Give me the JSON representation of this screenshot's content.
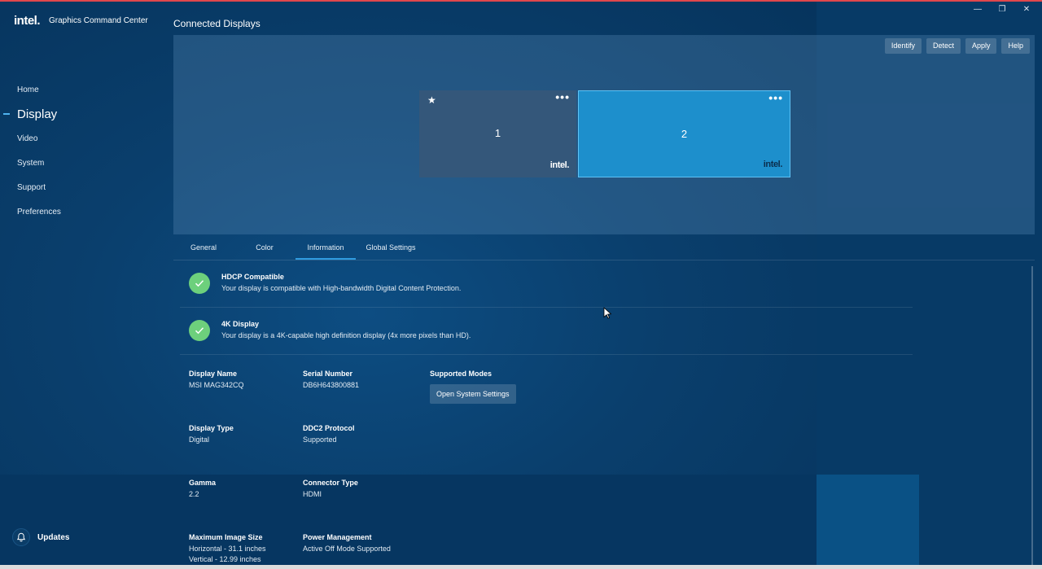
{
  "app": {
    "logo": "intel.",
    "title": "Graphics Command Center",
    "window_controls": [
      "—",
      "❐",
      "✕"
    ]
  },
  "sidebar": {
    "items": [
      {
        "label": "Home"
      },
      {
        "label": "Display",
        "active": true
      },
      {
        "label": "Video"
      },
      {
        "label": "System"
      },
      {
        "label": "Support"
      },
      {
        "label": "Preferences"
      }
    ],
    "updates_label": "Updates"
  },
  "connected_displays": {
    "title": "Connected Displays",
    "toolbar": {
      "identify": "Identify",
      "detect": "Detect",
      "apply": "Apply",
      "help": "Help"
    },
    "monitors": [
      {
        "number": "1",
        "primary_star": "★",
        "menu": "•••",
        "logo": "intel.",
        "selected": false
      },
      {
        "number": "2",
        "menu": "•••",
        "logo": "intel.",
        "selected": true
      }
    ]
  },
  "tabs": [
    {
      "label": "General"
    },
    {
      "label": "Color"
    },
    {
      "label": "Information",
      "active": true
    },
    {
      "label": "Global Settings"
    }
  ],
  "information": {
    "features": [
      {
        "title": "HDCP Compatible",
        "description": "Your display is compatible with High-bandwidth Digital Content Protection."
      },
      {
        "title": "4K Display",
        "description": "Your display is a 4K-capable high definition display (4x more pixels than HD)."
      }
    ],
    "fields": {
      "display_name": {
        "label": "Display Name",
        "value": "MSI MAG342CQ"
      },
      "serial_number": {
        "label": "Serial Number",
        "value": "DB6H643800881"
      },
      "supported_modes": {
        "label": "Supported Modes",
        "button": "Open System Settings"
      },
      "display_type": {
        "label": "Display Type",
        "value": "Digital"
      },
      "ddc2_protocol": {
        "label": "DDC2 Protocol",
        "value": "Supported"
      },
      "gamma": {
        "label": "Gamma",
        "value": "2.2"
      },
      "connector_type": {
        "label": "Connector Type",
        "value": "HDMI"
      },
      "max_image_size": {
        "label": "Maximum Image Size",
        "value_line1": "Horizontal - 31.1 inches",
        "value_line2": "Vertical - 12.99 inches"
      },
      "power_management": {
        "label": "Power Management",
        "value": "Active Off Mode Supported"
      }
    }
  },
  "colors": {
    "accent": "#2f9be0",
    "selected_monitor": "#1d8fcc",
    "check": "#6dd07c",
    "background": "#073863"
  }
}
